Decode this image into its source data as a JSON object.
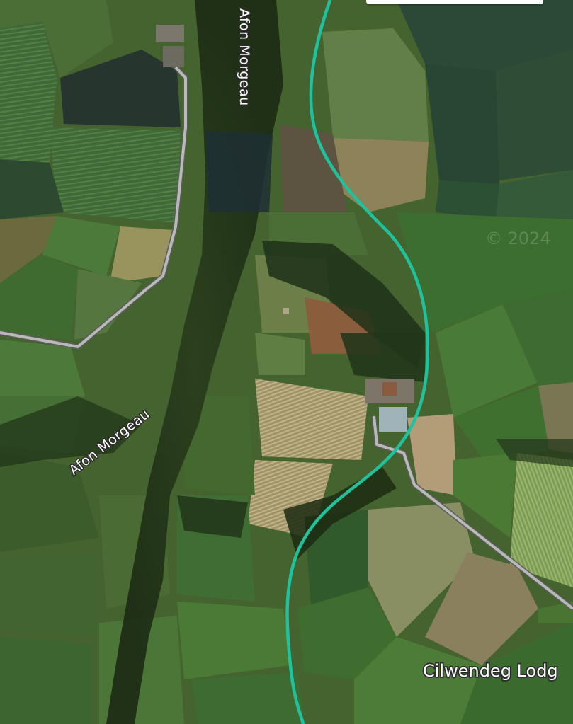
{
  "map": {
    "labels": {
      "river_north": "Afon Morgeau",
      "river_west": "Afon Morgeau",
      "place": "Cilwendeg Lodg"
    },
    "watermark": "© 2024",
    "colors": {
      "route": "#1fc29c",
      "road": "#b9b9b9",
      "road_outline": "#5c5c5c",
      "label_text": "#ffffff",
      "label_outline": "#2b2b2b"
    }
  }
}
